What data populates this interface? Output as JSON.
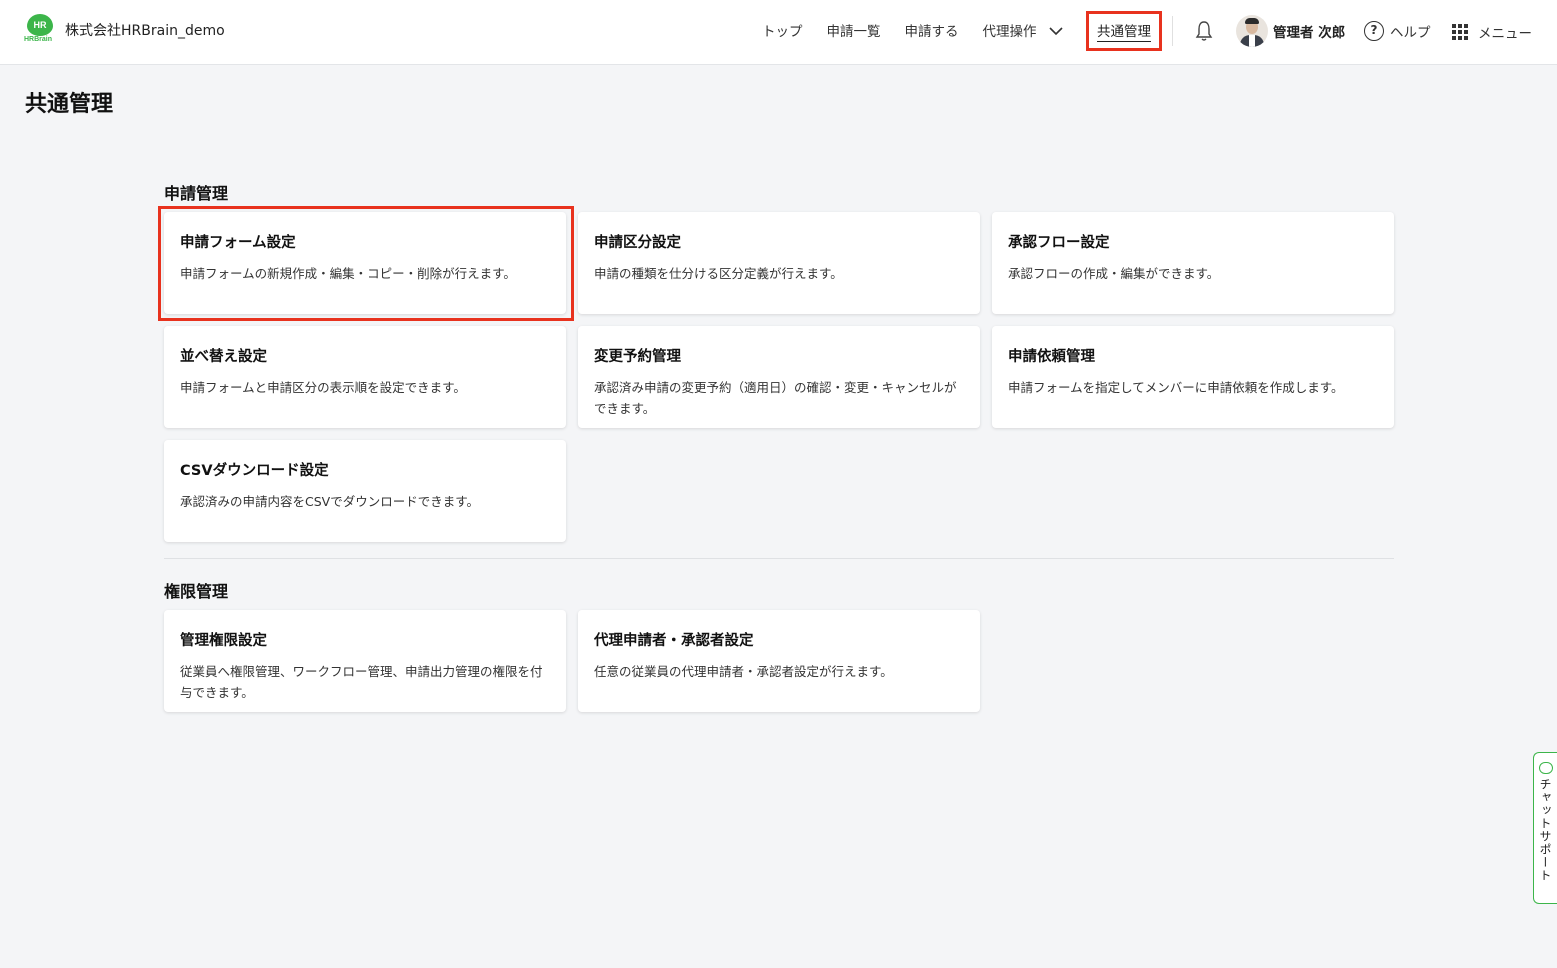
{
  "header": {
    "logo_text": "HR",
    "logo_word": "HRBrain",
    "company": "株式会社HRBrain_demo",
    "nav": [
      "トップ",
      "申請一覧",
      "申請する",
      "代理操作"
    ],
    "nav_active": "共通管理",
    "user_name": "管理者 次郎",
    "help": "ヘルプ",
    "menu": "メニュー"
  },
  "page": {
    "title": "共通管理"
  },
  "sections": [
    {
      "title": "申請管理",
      "cards": [
        {
          "title": "申請フォーム設定",
          "desc": "申請フォームの新規作成・編集・コピー・削除が行えます。"
        },
        {
          "title": "申請区分設定",
          "desc": "申請の種類を仕分ける区分定義が行えます。"
        },
        {
          "title": "承認フロー設定",
          "desc": "承認フローの作成・編集ができます。"
        },
        {
          "title": "並べ替え設定",
          "desc": "申請フォームと申請区分の表示順を設定できます。"
        },
        {
          "title": "変更予約管理",
          "desc": "承認済み申請の変更予約（適用日）の確認・変更・キャンセルができます。"
        },
        {
          "title": "申請依頼管理",
          "desc": "申請フォームを指定してメンバーに申請依頼を作成します。"
        },
        {
          "title": "CSVダウンロード設定",
          "desc": "承認済みの申請内容をCSVでダウンロードできます。"
        }
      ]
    },
    {
      "title": "権限管理",
      "cards": [
        {
          "title": "管理権限設定",
          "desc": "従業員へ権限管理、ワークフロー管理、申請出力管理の権限を付与できます。"
        },
        {
          "title": "代理申請者・承認者設定",
          "desc": "任意の従業員の代理申請者・承認者設定が行えます。"
        }
      ]
    }
  ],
  "chat_support": "チャットサポート",
  "colors": {
    "brand_green": "#3cb54a",
    "highlight_red": "#e8321e"
  }
}
